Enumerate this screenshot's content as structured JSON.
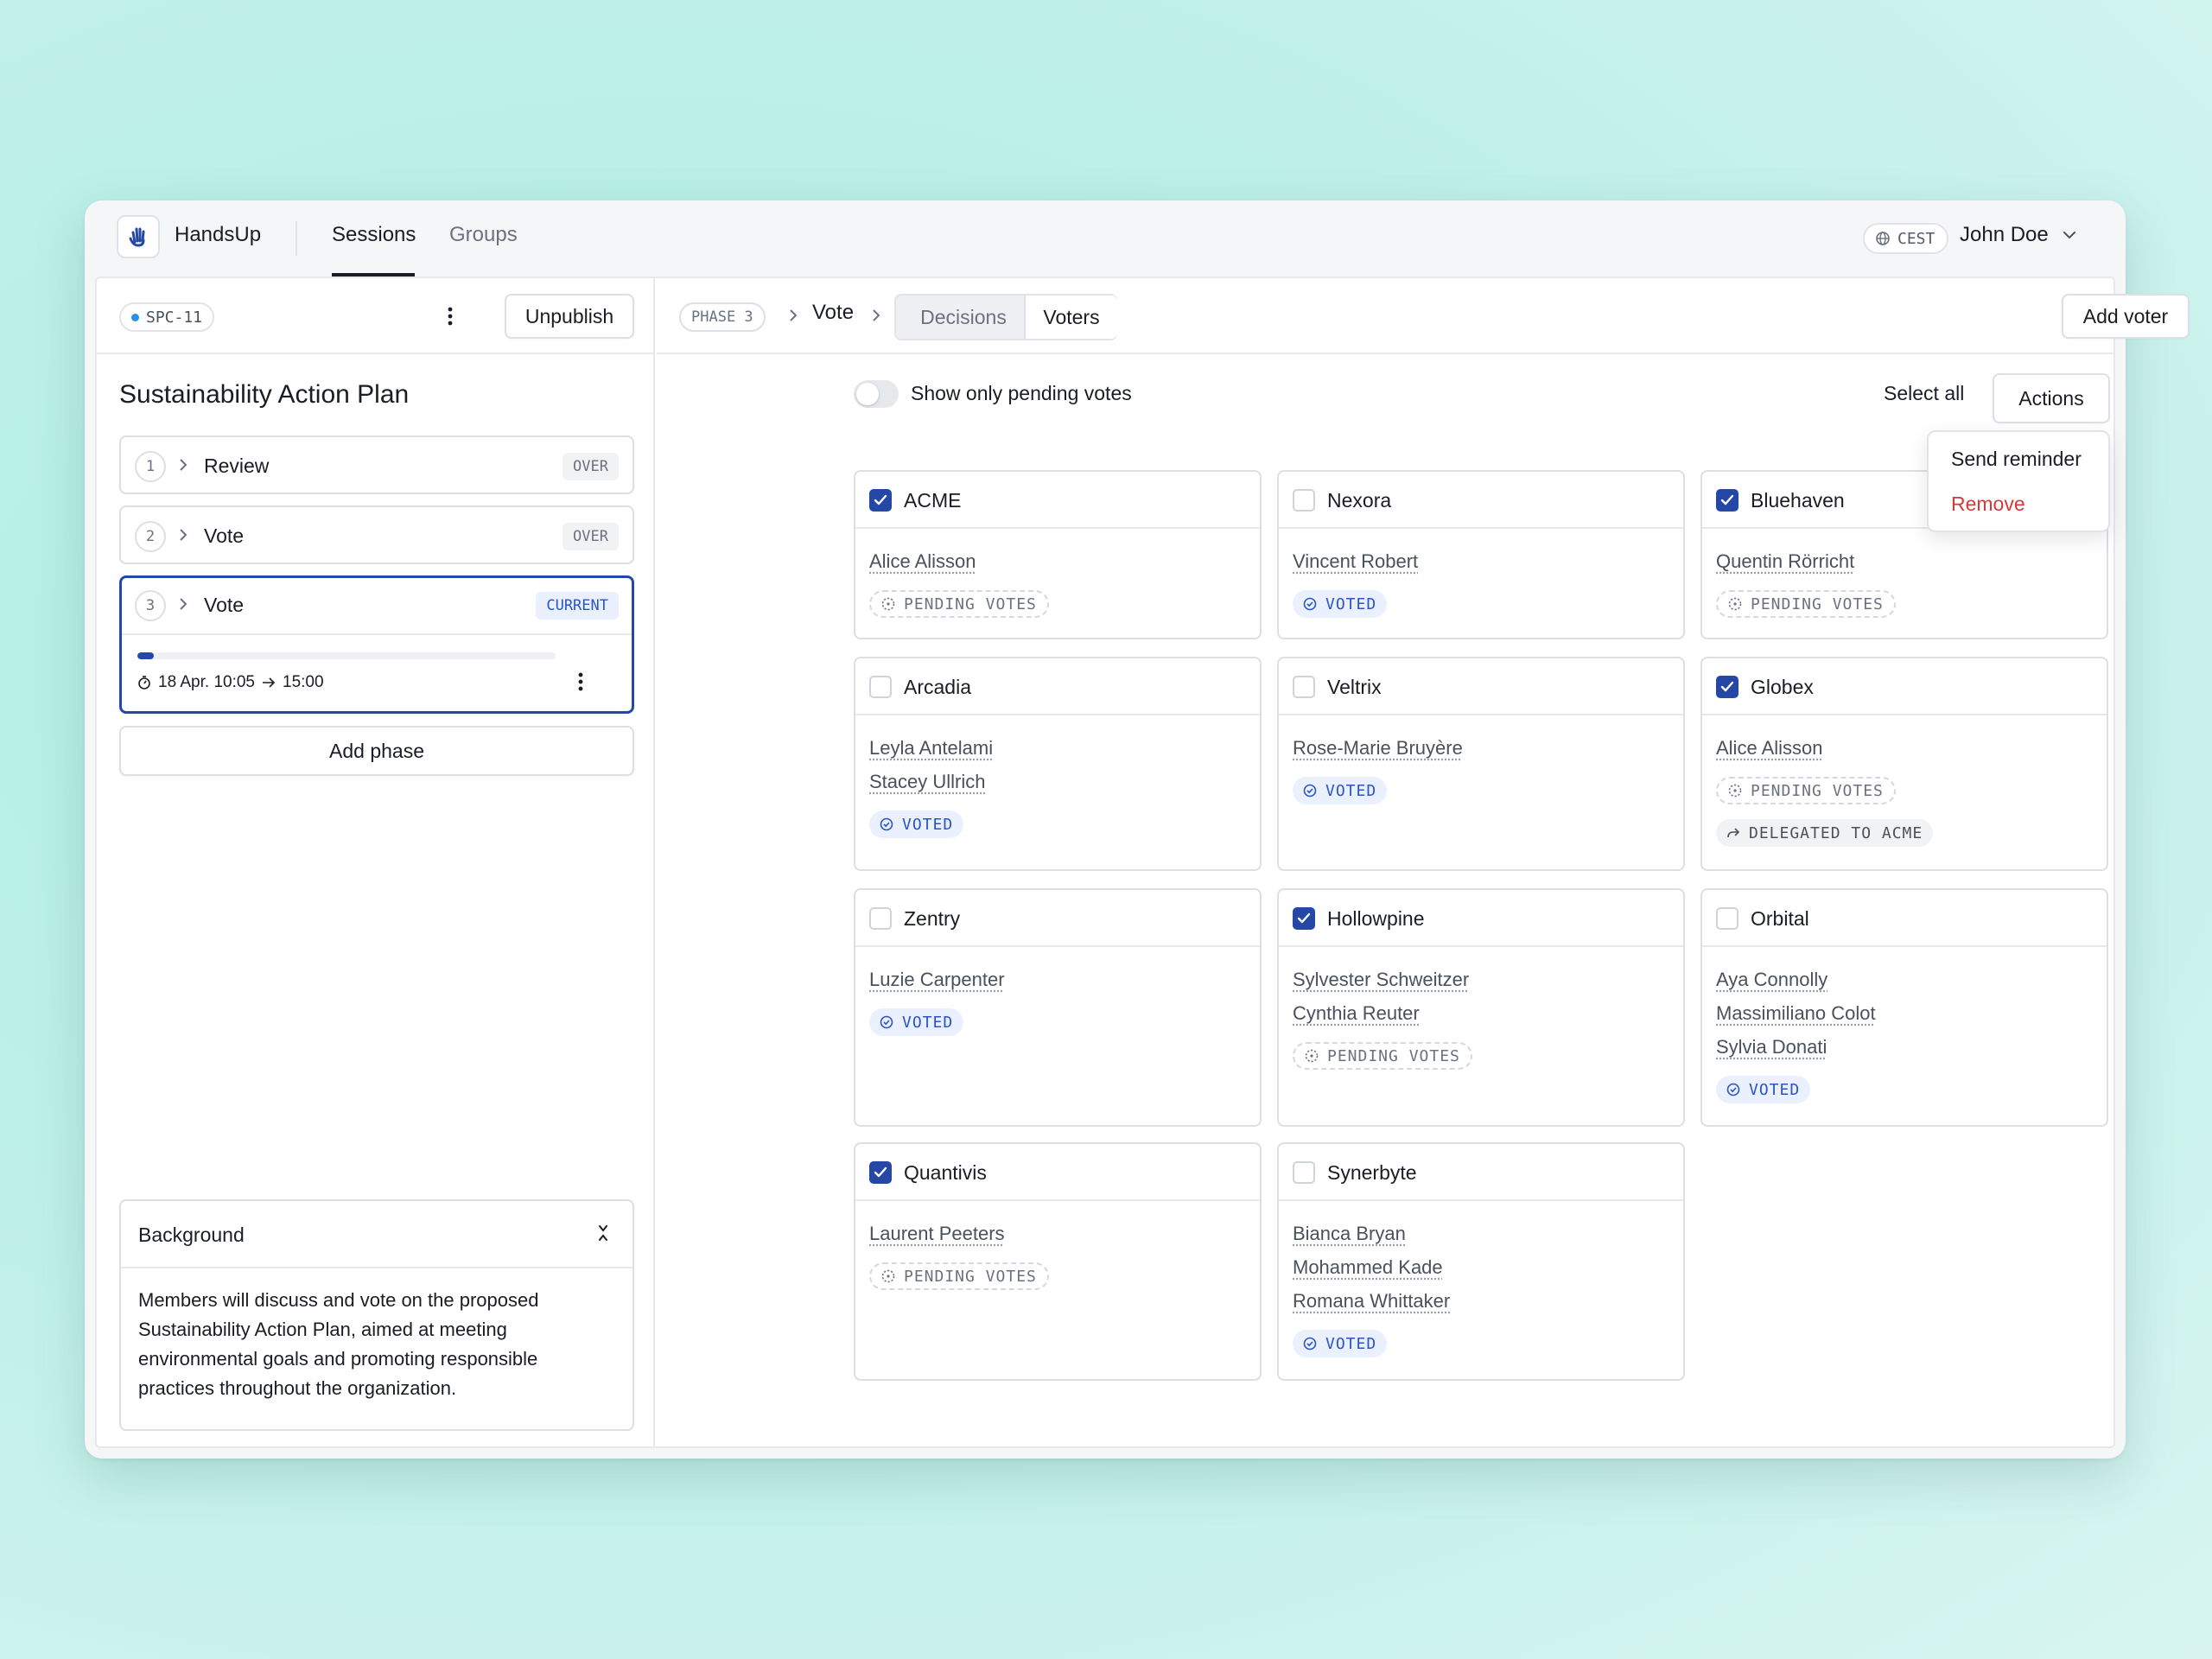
{
  "app": {
    "name": "HandsUp"
  },
  "nav": {
    "sessions": "Sessions",
    "groups": "Groups"
  },
  "header": {
    "timezone": "CEST",
    "user": "John Doe"
  },
  "sidebar": {
    "session_id": "SPC-11",
    "unpublish_label": "Unpublish",
    "title": "Sustainability Action Plan",
    "phases": [
      {
        "num": "1",
        "name": "Review",
        "state": "OVER"
      },
      {
        "num": "2",
        "name": "Vote",
        "state": "OVER"
      },
      {
        "num": "3",
        "name": "Vote",
        "state": "CURRENT",
        "progress": 0.04,
        "timing": {
          "start": "18 Apr. 10:05",
          "end": "15:00"
        }
      }
    ],
    "add_phase_label": "Add phase",
    "background": {
      "title": "Background",
      "text": "Members will discuss and vote on the proposed Sustainability Action Plan, aimed at meeting environmental goals and promoting responsible practices throughout the organization."
    }
  },
  "main": {
    "phase_badge": "PHASE 3",
    "crumb": "Vote",
    "tabs": {
      "decisions": "Decisions",
      "voters": "Voters"
    },
    "add_voter_label": "Add voter",
    "toggle_label": "Show only pending votes",
    "select_all_label": "Select all",
    "actions_label": "Actions",
    "menu": {
      "send_reminder": "Send reminder",
      "remove": "Remove"
    },
    "voters": [
      {
        "name": "ACME",
        "checked": true,
        "members": [
          "Alice Alisson"
        ],
        "tags": [
          {
            "type": "pending",
            "text": "PENDING VOTES"
          }
        ]
      },
      {
        "name": "Nexora",
        "checked": false,
        "members": [
          "Vincent Robert"
        ],
        "tags": [
          {
            "type": "voted",
            "text": "VOTED"
          }
        ]
      },
      {
        "name": "Bluehaven",
        "checked": true,
        "members": [
          "Quentin Rörricht"
        ],
        "tags": [
          {
            "type": "pending",
            "text": "PENDING VOTES"
          }
        ]
      },
      {
        "name": "Arcadia",
        "checked": false,
        "members": [
          "Leyla Antelami",
          "Stacey Ullrich"
        ],
        "tags": [
          {
            "type": "voted",
            "text": "VOTED"
          }
        ]
      },
      {
        "name": "Veltrix",
        "checked": false,
        "members": [
          "Rose-Marie Bruyère"
        ],
        "tags": [
          {
            "type": "voted",
            "text": "VOTED"
          }
        ]
      },
      {
        "name": "Globex",
        "checked": true,
        "members": [
          "Alice Alisson"
        ],
        "tags": [
          {
            "type": "pending",
            "text": "PENDING VOTES"
          },
          {
            "type": "deleg",
            "text": "DELEGATED TO ACME"
          }
        ]
      },
      {
        "name": "Zentry",
        "checked": false,
        "members": [
          "Luzie Carpenter"
        ],
        "tags": [
          {
            "type": "voted",
            "text": "VOTED"
          }
        ]
      },
      {
        "name": "Hollowpine",
        "checked": true,
        "members": [
          "Sylvester Schweitzer",
          "Cynthia Reuter"
        ],
        "tags": [
          {
            "type": "pending",
            "text": "PENDING VOTES"
          }
        ]
      },
      {
        "name": "Orbital",
        "checked": false,
        "members": [
          "Aya Connolly",
          "Massimiliano Colot",
          "Sylvia Donati"
        ],
        "tags": [
          {
            "type": "voted",
            "text": "VOTED"
          }
        ]
      },
      {
        "name": "Quantivis",
        "checked": true,
        "members": [
          "Laurent Peeters"
        ],
        "tags": [
          {
            "type": "pending",
            "text": "PENDING VOTES"
          }
        ]
      },
      {
        "name": "Synerbyte",
        "checked": false,
        "members": [
          "Bianca Bryan",
          "Mohammed Kade",
          "Romana Whittaker"
        ],
        "tags": [
          {
            "type": "voted",
            "text": "VOTED"
          }
        ]
      }
    ]
  },
  "colors": {
    "accent": "#2548a6",
    "voted_bg": "#eaf0fd",
    "voted_text": "#2a55c9",
    "danger": "#d33a3a"
  }
}
